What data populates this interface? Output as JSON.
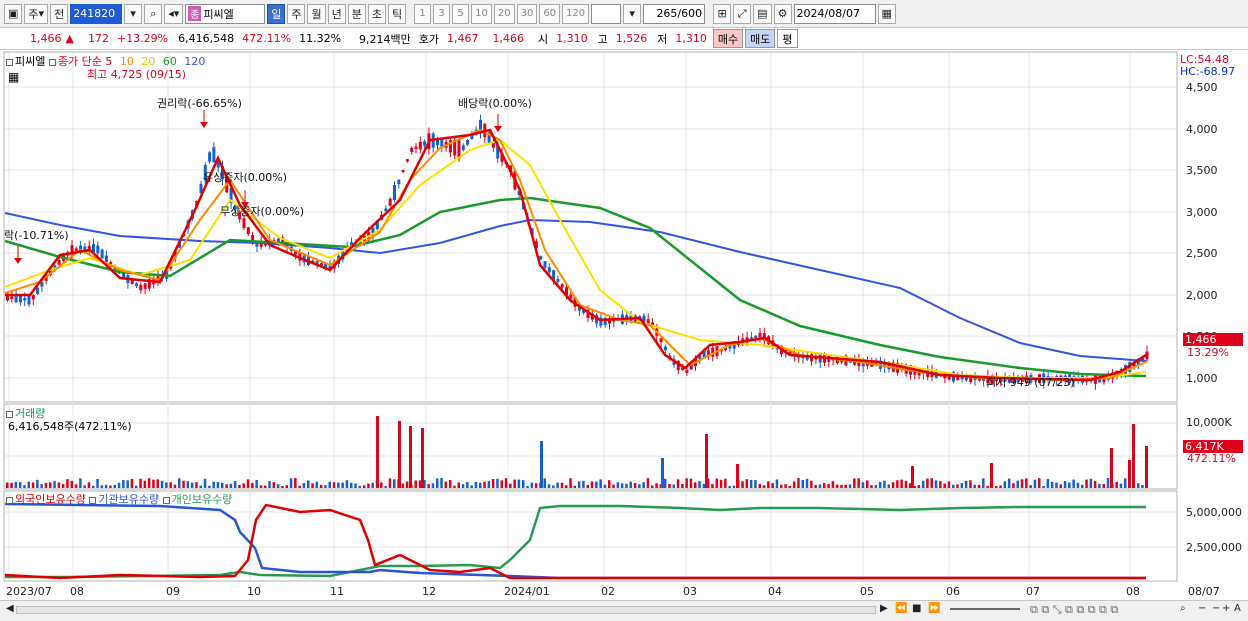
{
  "toolbar": {
    "market": "주",
    "prev_label": "전",
    "code": "241820",
    "stock_badge": "종",
    "stock_name": "피씨엘",
    "period_buttons": [
      "일",
      "주",
      "월",
      "년",
      "분",
      "초",
      "틱"
    ],
    "interval_buttons": [
      "1",
      "3",
      "5",
      "10",
      "20",
      "30",
      "60",
      "120"
    ],
    "count": "265",
    "count_max": "/600",
    "date": "2024/08/07"
  },
  "quote": {
    "price": "1,466",
    "change": "172",
    "change_pct": "+13.29%",
    "volume": "6,416,548",
    "volume_pct": "472.11%",
    "turnover": "11.32%",
    "amount": "9,214백만",
    "ask_label": "호가",
    "ask": "1,467",
    "bid": "1,466",
    "open_label": "시",
    "open": "1,310",
    "high_label": "고",
    "high": "1,526",
    "low_label": "저",
    "low": "1,310",
    "buy_label": "매수",
    "sell_label": "매도",
    "eval_label": "평"
  },
  "price_pane": {
    "name": "피씨엘",
    "legend_prefix": "종가 단순",
    "ma_labels": [
      "5",
      "10",
      "20",
      "60",
      "120"
    ],
    "high_note": "최고 4,725 (09/15)",
    "low_note": "최저 949 (07/23)",
    "lc": "LC:54.48",
    "hc": "HC:-68.97",
    "y_ticks": [
      "4,500",
      "4,000",
      "3,500",
      "3,000",
      "2,500",
      "2,000",
      "1,500",
      "1,000"
    ],
    "price_tag": "1,466",
    "price_tag_pct": "13.29%",
    "annotations": [
      "권리락(-66.65%)",
      "배당락(0.00%)",
      "유상증자(0.00%)",
      "무상증자(0.00%)",
      "락(-10.71%)"
    ]
  },
  "volume_pane": {
    "title": "거래량",
    "value": "6,416,548주(472.11%)",
    "y_tick": "10,000K",
    "tag": "6,417K",
    "tag_pct": "472.11%"
  },
  "holding_pane": {
    "legend": [
      "외국인보유수량",
      "기관보유수량",
      "개인보유수량"
    ],
    "y_ticks": [
      "5,000,000",
      "2,500,000"
    ]
  },
  "dates": [
    "2023/07",
    "08",
    "09",
    "10",
    "11",
    "12",
    "2024/01",
    "02",
    "03",
    "04",
    "05",
    "06",
    "07",
    "08",
    "08/07"
  ],
  "colors": {
    "ma5": "#e00000",
    "ma10": "#ff8c00",
    "ma20": "#ffe000",
    "ma60": "#1a9a2a",
    "ma120": "#3355e0",
    "up": "#e0001b",
    "down": "#1560d0",
    "foreign": "#e00000",
    "institution": "#2a55d8",
    "individual": "#2a9a50"
  }
}
